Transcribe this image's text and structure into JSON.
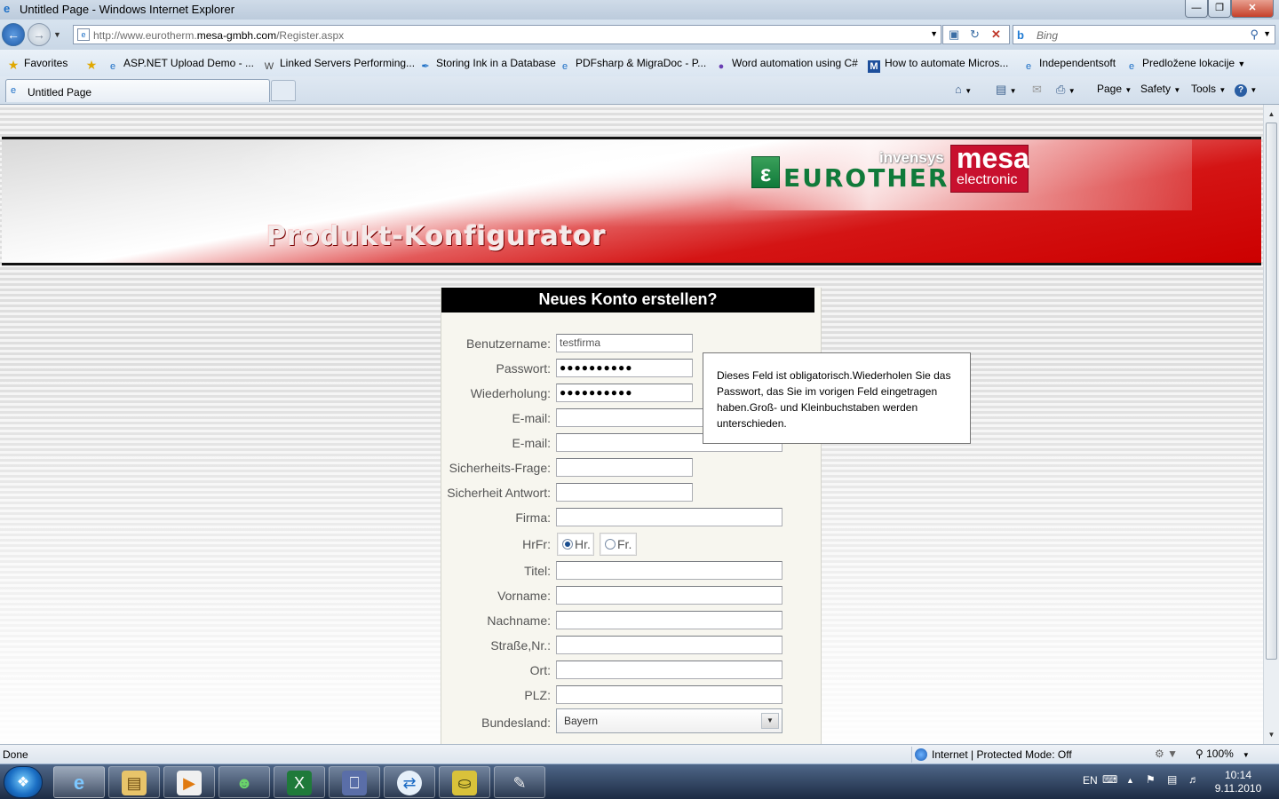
{
  "window": {
    "title": "Untitled Page - Windows Internet Explorer",
    "min_glyph": "—",
    "max_glyph": "❐",
    "close_glyph": "✕"
  },
  "address_bar": {
    "url_prefix": "http://www.eurotherm.",
    "url_domain": "mesa-gmbh.com",
    "url_path": "/Register.aspx",
    "search_placeholder": "Bing"
  },
  "favorites": {
    "label": "Favorites",
    "items": [
      "ASP.NET Upload Demo - ...",
      "Linked Servers Performing...",
      "Storing Ink in a Database",
      "PDFsharp & MigraDoc - P...",
      "Word automation using C#",
      "How to automate Micros...",
      "Independentsoft",
      "Predložene lokacije"
    ]
  },
  "tabs": {
    "active_label": "Untitled Page"
  },
  "command_bar": {
    "page": "Page",
    "safety": "Safety",
    "tools": "Tools"
  },
  "banner": {
    "headline": "Produkt-Konfigurator",
    "brand_invensys": "invensys",
    "brand_eurotherm": "EUROTHERM",
    "brand_mesa": "mesa",
    "brand_electronic": "electronic"
  },
  "form": {
    "title": "Neues Konto erstellen?",
    "labels": {
      "username": "Benutzername:",
      "password": "Passwort:",
      "repeat": "Wiederholung:",
      "email1": "E-mail:",
      "email2": "E-mail:",
      "question": "Sicherheits-Frage:",
      "answer": "Sicherheit Antwort:",
      "company": "Firma:",
      "salutation": "HrFr:",
      "title": "Titel:",
      "firstname": "Vorname:",
      "lastname": "Nachname:",
      "street": "Straße,Nr.:",
      "city": "Ort:",
      "zip": "PLZ:",
      "state": "Bundesland:"
    },
    "values": {
      "username": "testfirma",
      "password": "●●●●●●●●●●",
      "repeat": "●●●●●●●●●●",
      "state": "Bayern"
    },
    "radio": {
      "mr": "Hr.",
      "mrs": "Fr.",
      "selected": "Hr."
    }
  },
  "tooltip": {
    "text": "Dieses Feld ist obligatorisch.Wiederholen Sie das Passwort, das Sie im vorigen Feld eingetragen haben.Groß- und Kleinbuchstaben werden unterschieden."
  },
  "status_bar": {
    "status": "Done",
    "zone": "Internet | Protected Mode: Off",
    "zoom": "100%"
  },
  "taskbar": {
    "language": "EN",
    "time": "10:14",
    "date": "9.11.2010"
  },
  "colors": {
    "banner_red": "#cc0000",
    "eurotherm_green": "#107a3a",
    "mesa_red": "#c8102e"
  }
}
